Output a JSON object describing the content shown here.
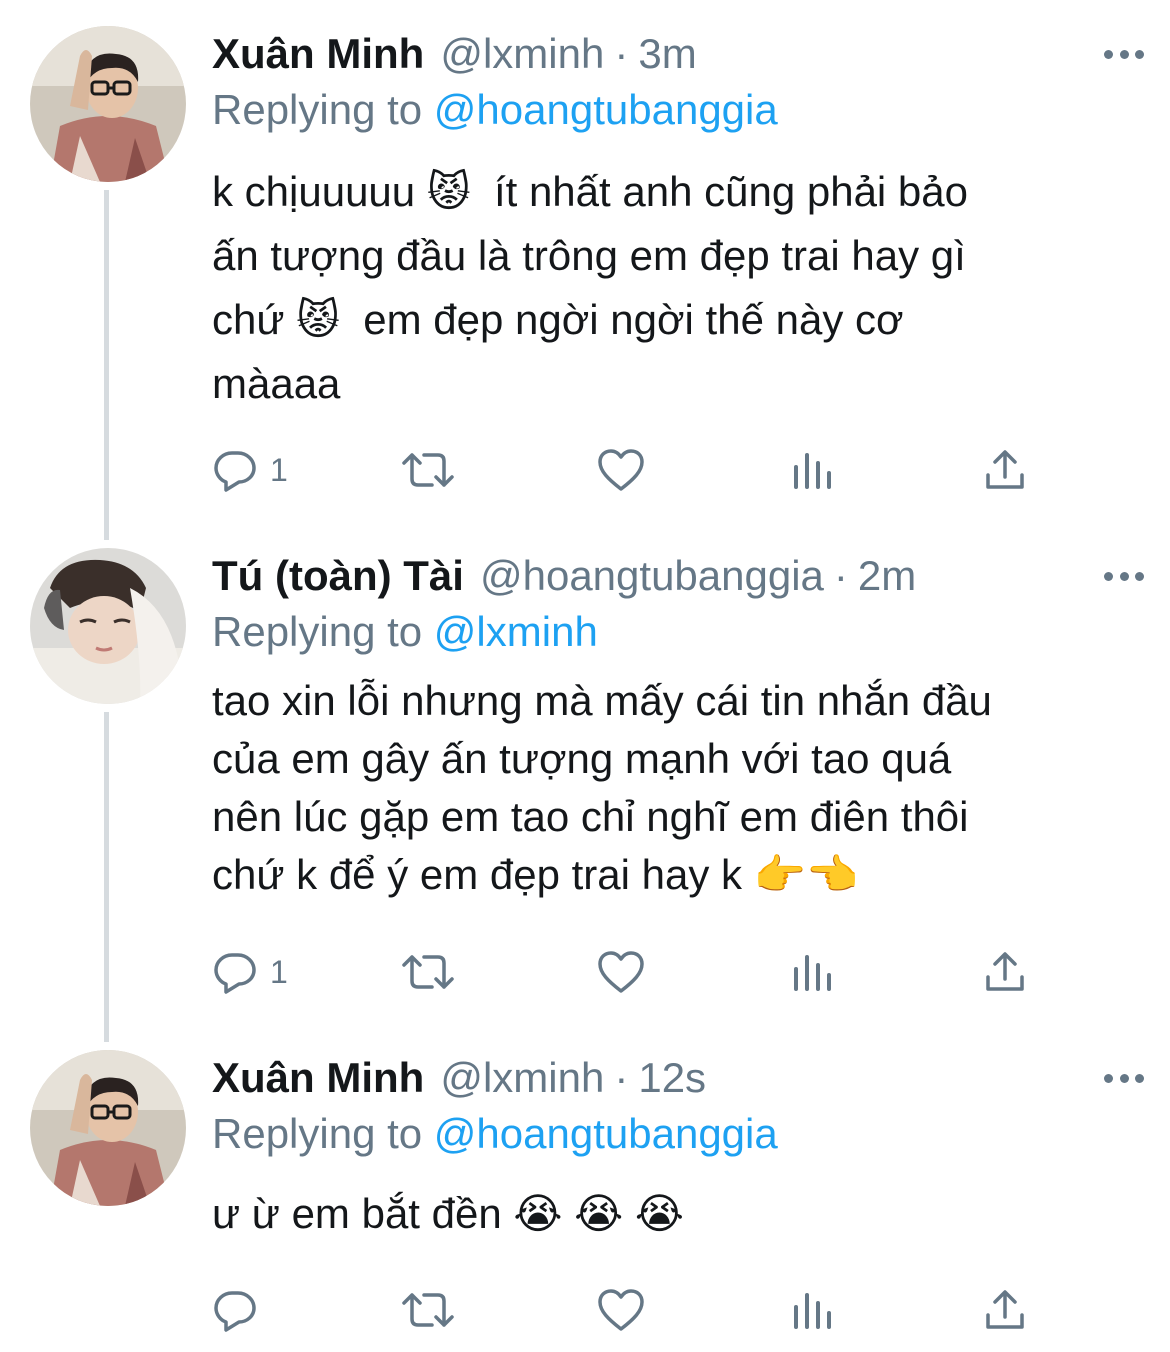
{
  "colors": {
    "name": "#14171a",
    "secondary": "#657786",
    "mention": "#1da1f2",
    "thread_line": "#d6dbdf",
    "background": "#ffffff"
  },
  "tweets": [
    {
      "display_name": "Xuân Minh",
      "handle": "@lxminh",
      "separator": "·",
      "time": "3m",
      "replying_prefix": "Replying to",
      "replying_to": "@hoangtubanggia",
      "text": "k chịuuuuu 😾  ít nhất anh cũng phải bảo\nấn tượng đầu là trông em đẹp trai hay gì\nchứ 😾  em đẹp ngời ngời thế này cơ\nmàaaa",
      "reply_count": "1",
      "avatar_icon": "avatar-photo"
    },
    {
      "display_name": "Tú (toàn) Tài",
      "handle": "@hoangtubanggia",
      "separator": "·",
      "time": "2m",
      "replying_prefix": "Replying to",
      "replying_to": "@lxminh",
      "text": "tao xin lỗi nhưng mà mấy cái tin nhắn đầu\ncủa em gây ấn tượng mạnh với tao quá\nnên lúc gặp em tao chỉ nghĩ em điên thôi\nchứ k để ý em đẹp trai hay k 👉👈",
      "reply_count": "1",
      "avatar_icon": "avatar-photo"
    },
    {
      "display_name": "Xuân Minh",
      "handle": "@lxminh",
      "separator": "·",
      "time": "12s",
      "replying_prefix": "Replying to",
      "replying_to": "@hoangtubanggia",
      "text": "ư ừ em bắt đền 😭 😭 😭",
      "reply_count": "",
      "avatar_icon": "avatar-photo"
    }
  ],
  "icons": {
    "reply": "reply-icon",
    "retweet": "retweet-icon",
    "like": "heart-icon",
    "analytics": "analytics-icon",
    "share": "share-icon",
    "more": "more-icon"
  }
}
